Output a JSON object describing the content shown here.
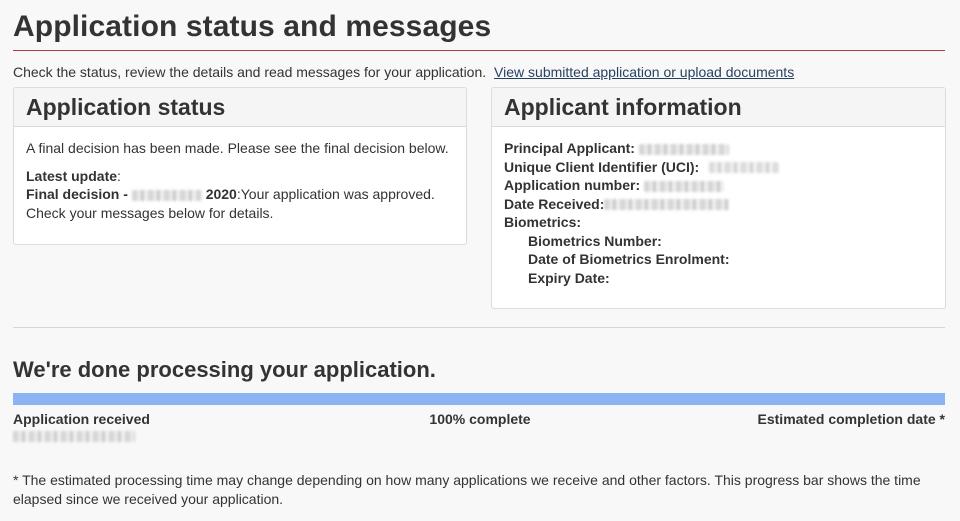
{
  "page": {
    "title": "Application status and messages",
    "intro_text": "Check the status, review the details and read messages for your application.",
    "intro_link": "View submitted application or upload documents"
  },
  "status_panel": {
    "heading": "Application status",
    "decision_text": "A final decision has been made. Please see the final decision below.",
    "latest_update_label": "Latest update",
    "latest_update_colon": ":",
    "final_decision_prefix": "Final decision -",
    "final_decision_year": "2020",
    "final_decision_text": ":Your application was approved.",
    "check_messages": "Check your messages below for details."
  },
  "applicant_panel": {
    "heading": "Applicant information",
    "principal_applicant_label": "Principal Applicant:",
    "uci_label": "Unique Client Identifier (UCI):",
    "application_number_label": "Application number:",
    "date_received_label": "Date Received:",
    "biometrics_label": "Biometrics:",
    "biometrics_number_label": "Biometrics Number:",
    "biometrics_enrolment_label": "Date of Biometrics Enrolment:",
    "expiry_date_label": "Expiry Date:"
  },
  "processing": {
    "heading": "We're done processing your application.",
    "progress_percent": 100,
    "received_label": "Application received",
    "complete_label": "100% complete",
    "estimated_label": "Estimated completion date *",
    "colors": {
      "fill": "#8cb4f3",
      "track": "#e6e6e6"
    }
  },
  "footnote": "* The estimated processing time may change depending on how many applications we receive and other factors. This progress bar shows the time elapsed since we received your application.",
  "colors": {
    "title_rule": "#af3c43",
    "link": "#284162"
  }
}
